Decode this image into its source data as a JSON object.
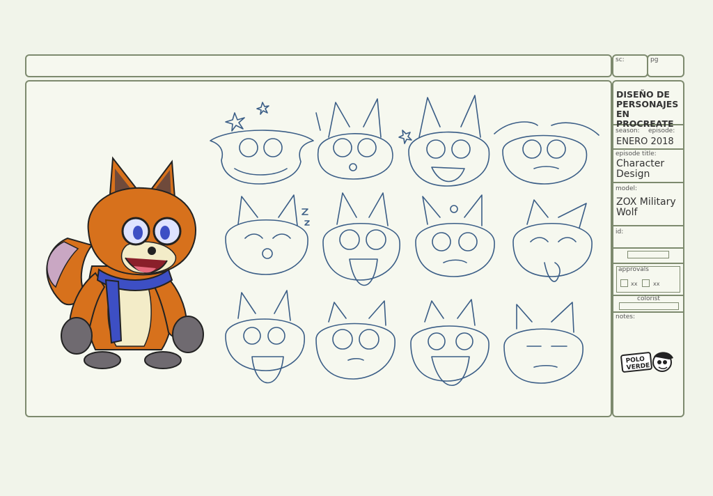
{
  "header": {
    "sc_label": "sc:",
    "pg_label": "pg"
  },
  "sidebar": {
    "title": "DISEÑO DE PERSONAJES EN PROCREATE",
    "season_label": "season:",
    "episode_label": "episode:",
    "season_value": "ENERO 2018",
    "episode_title_label": "episode title:",
    "episode_title_value": "Character Design",
    "model_label": "model:",
    "model_value": "ZOX Military Wolf",
    "id_label": "id:",
    "approvals_label": "approvals",
    "approval_1": "xx",
    "approval_2": "xx",
    "colorist_label": "colorist",
    "notes_label": "notes:",
    "logo_text": "POLO VERDE"
  },
  "colors": {
    "frame": "#7d8a6e",
    "sketch_ink": "#3a5d86",
    "fur_orange": "#d7711c",
    "scarf_blue": "#3d4fc4",
    "background": "#f1f4ea"
  }
}
